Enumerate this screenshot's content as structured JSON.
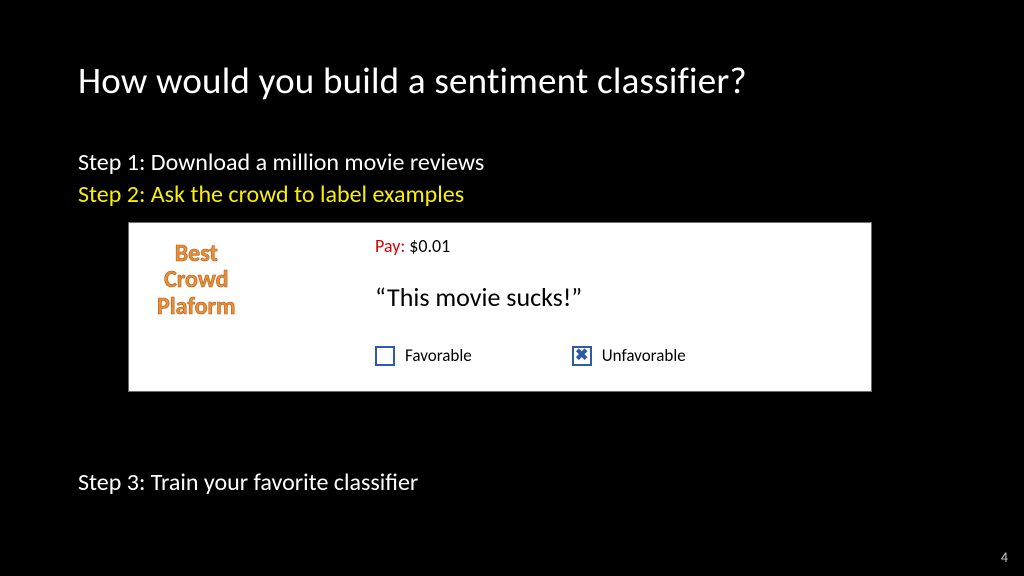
{
  "title": "How would you build a sentiment classifier?",
  "step1": "Step 1: Download a million movie reviews",
  "step2": "Step 2: Ask the crowd to label examples",
  "step3": "Step 3: Train your favorite classifier",
  "card": {
    "platform_line1": "Best",
    "platform_line2": "Crowd",
    "platform_line3": "Plaform",
    "pay_label": "Pay:",
    "pay_value": " $0.01",
    "quote": "“This movie sucks!”",
    "option_favorable": "Favorable",
    "option_unfavorable": "Unfavorable",
    "unfavorable_mark": "✖"
  },
  "page_number": "4"
}
